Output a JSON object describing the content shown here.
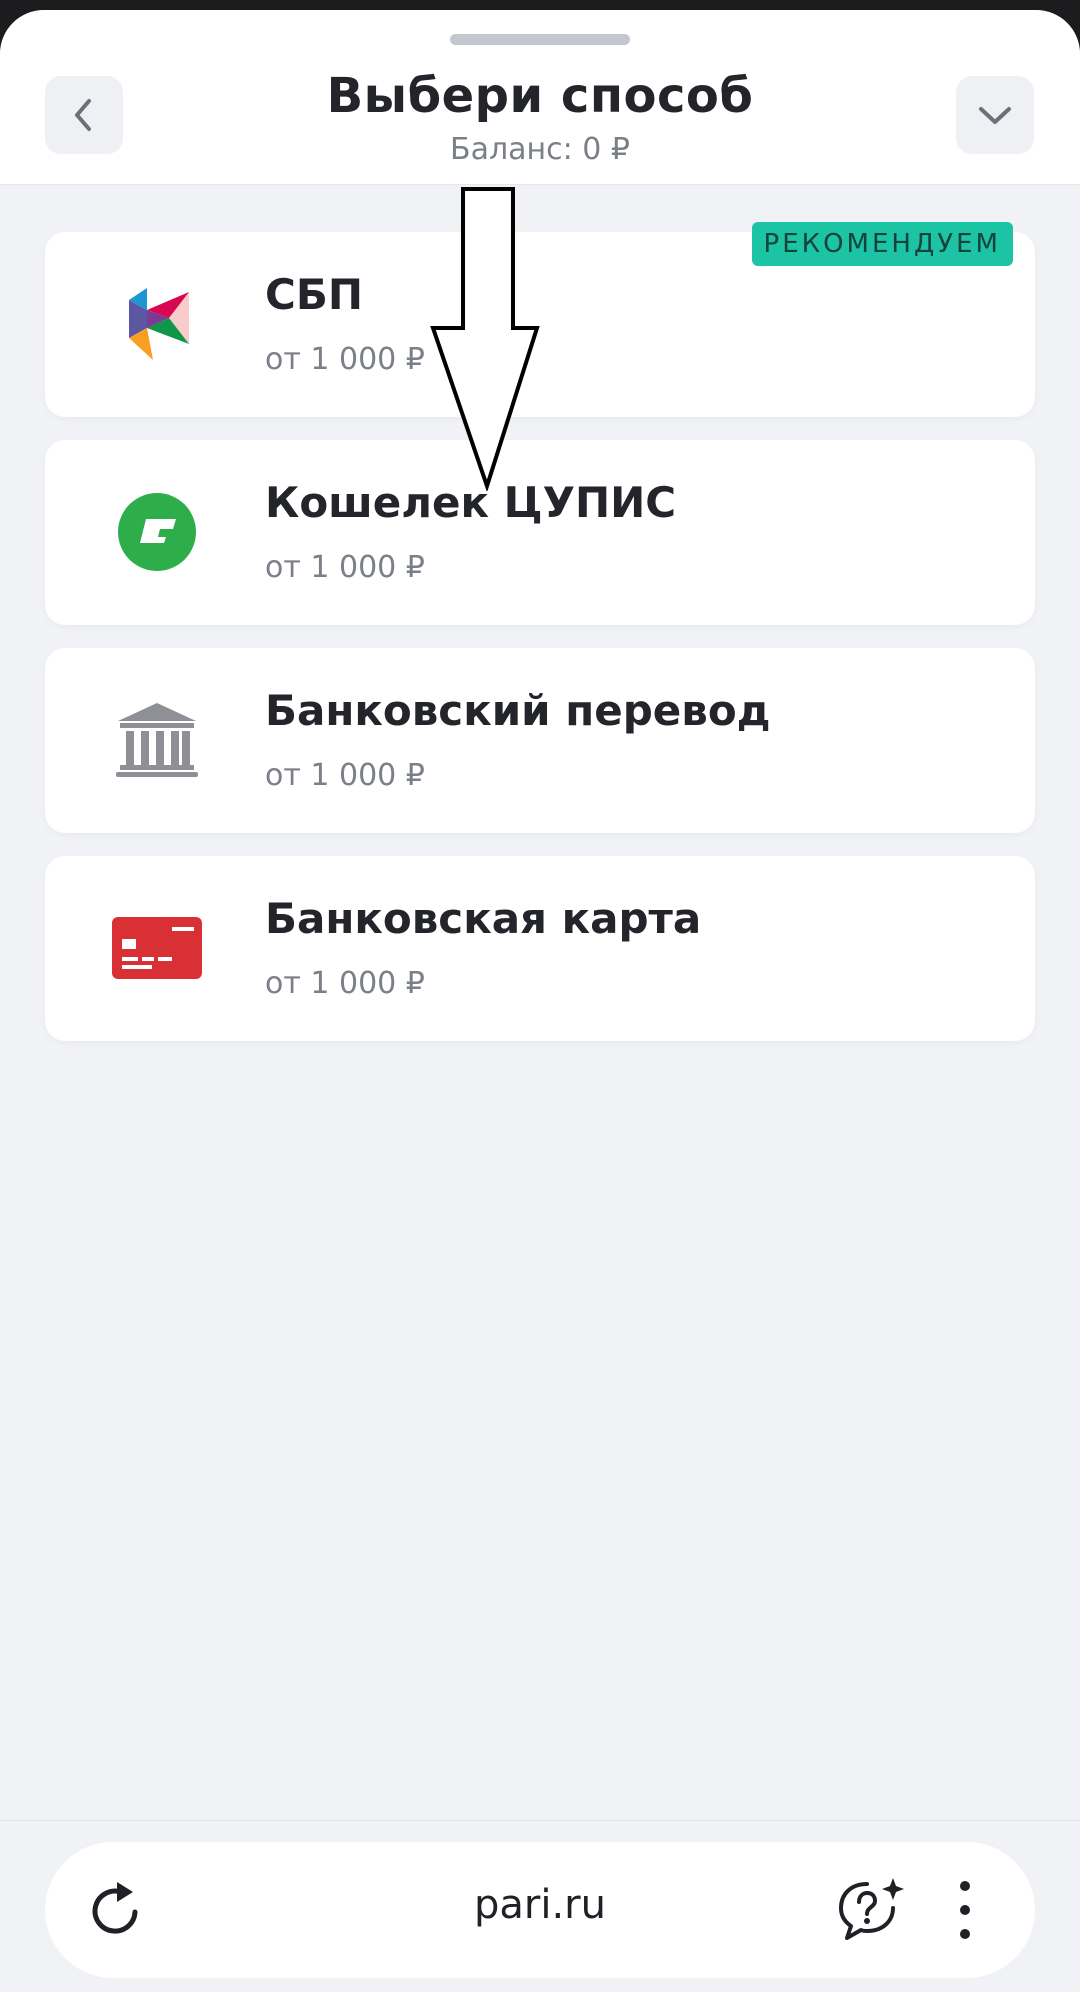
{
  "header": {
    "title": "Выбери способ",
    "subtitle": "Баланс: 0 ₽"
  },
  "methods": [
    {
      "name": "СБП",
      "min": "от 1 000 ₽",
      "badge": "РЕКОМЕНДУЕМ",
      "icon": "sbp-icon"
    },
    {
      "name": "Кошелек ЦУПИС",
      "min": "от 1 000 ₽",
      "icon": "cupis-wallet-icon"
    },
    {
      "name": "Банковский перевод",
      "min": "от 1 000 ₽",
      "icon": "bank-building-icon"
    },
    {
      "name": "Банковская карта",
      "min": "от 1 000 ₽",
      "icon": "bank-card-icon"
    }
  ],
  "browser": {
    "url": "pari.ru"
  },
  "colors": {
    "badge": "#1cc3a5",
    "cupis": "#2eae4b",
    "card": "#d93035",
    "bank": "#8e9095"
  }
}
